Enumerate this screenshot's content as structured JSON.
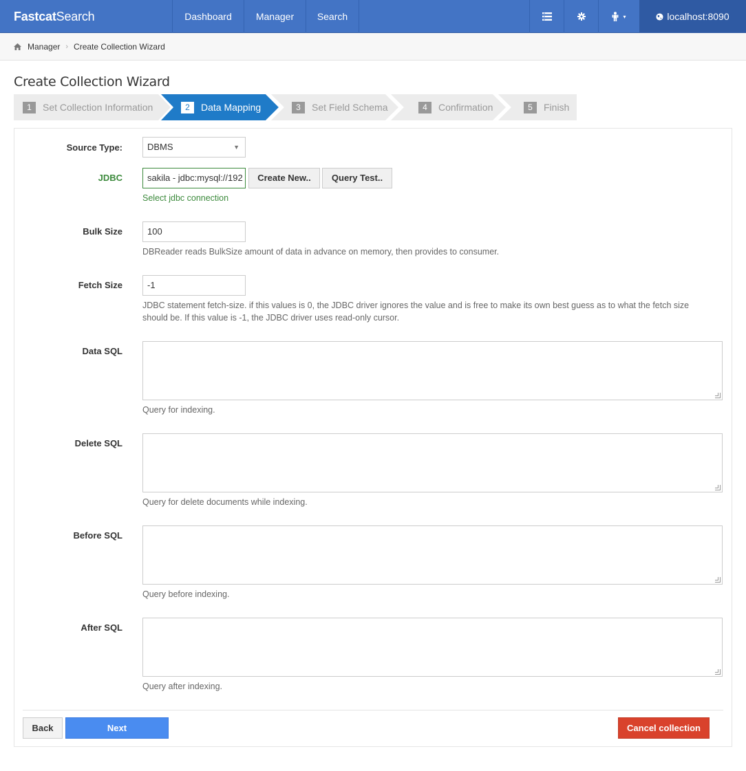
{
  "navbar": {
    "brand_bold": "Fastcat",
    "brand_light": "Search",
    "items": [
      {
        "label": "Dashboard"
      },
      {
        "label": "Manager"
      },
      {
        "label": "Search"
      }
    ],
    "host": "localhost:8090",
    "icons": [
      "list-icon",
      "gear-icon",
      "user-icon",
      "globe-icon"
    ]
  },
  "breadcrumb": {
    "home": "Manager",
    "current": "Create Collection Wizard"
  },
  "page": {
    "title": "Create Collection Wizard"
  },
  "wizard": {
    "steps": [
      {
        "num": "1",
        "label": "Set Collection Information"
      },
      {
        "num": "2",
        "label": "Data Mapping"
      },
      {
        "num": "3",
        "label": "Set Field Schema"
      },
      {
        "num": "4",
        "label": "Confirmation"
      },
      {
        "num": "5",
        "label": "Finish"
      }
    ],
    "active_step": 2,
    "active_color": "#1f7bc8"
  },
  "form": {
    "source_type": {
      "label": "Source Type:",
      "value": "DBMS"
    },
    "jdbc": {
      "label": "JDBC",
      "value": "sakila - jdbc:mysql://192",
      "help": "Select jdbc connection",
      "create_new": "Create New..",
      "query_test": "Query Test.."
    },
    "bulk_size": {
      "label": "Bulk Size",
      "value": "100",
      "help": "DBReader reads BulkSize amount of data in advance on memory, then provides to consumer."
    },
    "fetch_size": {
      "label": "Fetch Size",
      "value": "-1",
      "help_line1": "JDBC statement fetch-size. if this values is 0, the JDBC driver ignores the value and is free to make its own best guess as to what the fetch size",
      "help_line2": "should be. If this value is -1, the JDBC driver uses read-only cursor."
    },
    "data_sql": {
      "label": "Data SQL",
      "value": "",
      "help": "Query for indexing."
    },
    "delete_sql": {
      "label": "Delete SQL",
      "value": "",
      "help": "Query for delete documents while indexing."
    },
    "before_sql": {
      "label": "Before SQL",
      "value": "",
      "help": "Query before indexing."
    },
    "after_sql": {
      "label": "After SQL",
      "value": "",
      "help": "Query after indexing."
    }
  },
  "actions": {
    "back": "Back",
    "next": "Next",
    "cancel": "Cancel collection"
  },
  "colors": {
    "navbar": "#4374c5",
    "next": "#4a8cf0",
    "cancel": "#d9422c",
    "jdbc_green": "#3c8a3c"
  }
}
